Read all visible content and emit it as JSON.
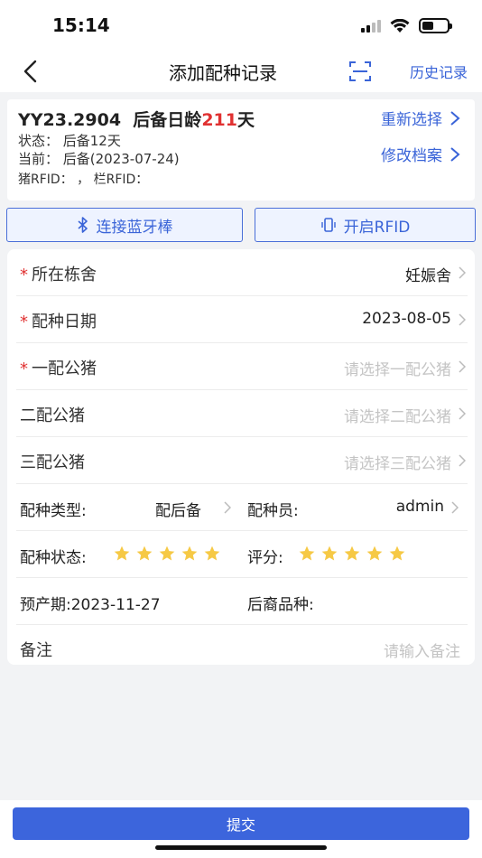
{
  "status_bar": {
    "time": "15:14"
  },
  "nav": {
    "title": "添加配种记录",
    "history_label": "历史记录",
    "back_icon": "chevron-left-icon",
    "scan_icon": "scan-icon"
  },
  "pig": {
    "id": "YY23.2904",
    "age_prefix": "后备日龄",
    "age_days": "211",
    "age_suffix": "天",
    "status_line": "状态：  后备12天",
    "current_line": "当前：  后备(2023-07-24)",
    "rfid_line": "猪RFID：  ，  栏RFID：",
    "reselect_label": "重新选择",
    "edit_label": "修改档案"
  },
  "actions": {
    "bluetooth_label": "连接蓝牙棒",
    "rfid_label": "开启RFID"
  },
  "form": {
    "barn": {
      "label": "所在栋舍",
      "value": "妊娠舍",
      "required": true
    },
    "date": {
      "label": "配种日期",
      "value": "2023-08-05",
      "required": true
    },
    "boar1": {
      "label": "一配公猪",
      "placeholder": "请选择一配公猪",
      "required": true
    },
    "boar2": {
      "label": "二配公猪",
      "placeholder": "请选择二配公猪"
    },
    "boar3": {
      "label": "三配公猪",
      "placeholder": "请选择三配公猪"
    },
    "breed_type": {
      "label": "配种类型:",
      "value": "配后备"
    },
    "breeder": {
      "label": "配种员:",
      "value": "admin"
    },
    "breed_status": {
      "label": "配种状态:",
      "stars": 5
    },
    "score": {
      "label": "评分:",
      "stars": 5
    },
    "due_date": {
      "label": "预产期:",
      "value": "2023-11-27"
    },
    "offspring_breed": {
      "label": "后裔品种:"
    },
    "remark": {
      "label": "备注",
      "placeholder": "请输入备注"
    }
  },
  "submit_label": "提交",
  "colors": {
    "accent": "#3a64d8",
    "required": "#e03131",
    "star": "#f6c945"
  }
}
